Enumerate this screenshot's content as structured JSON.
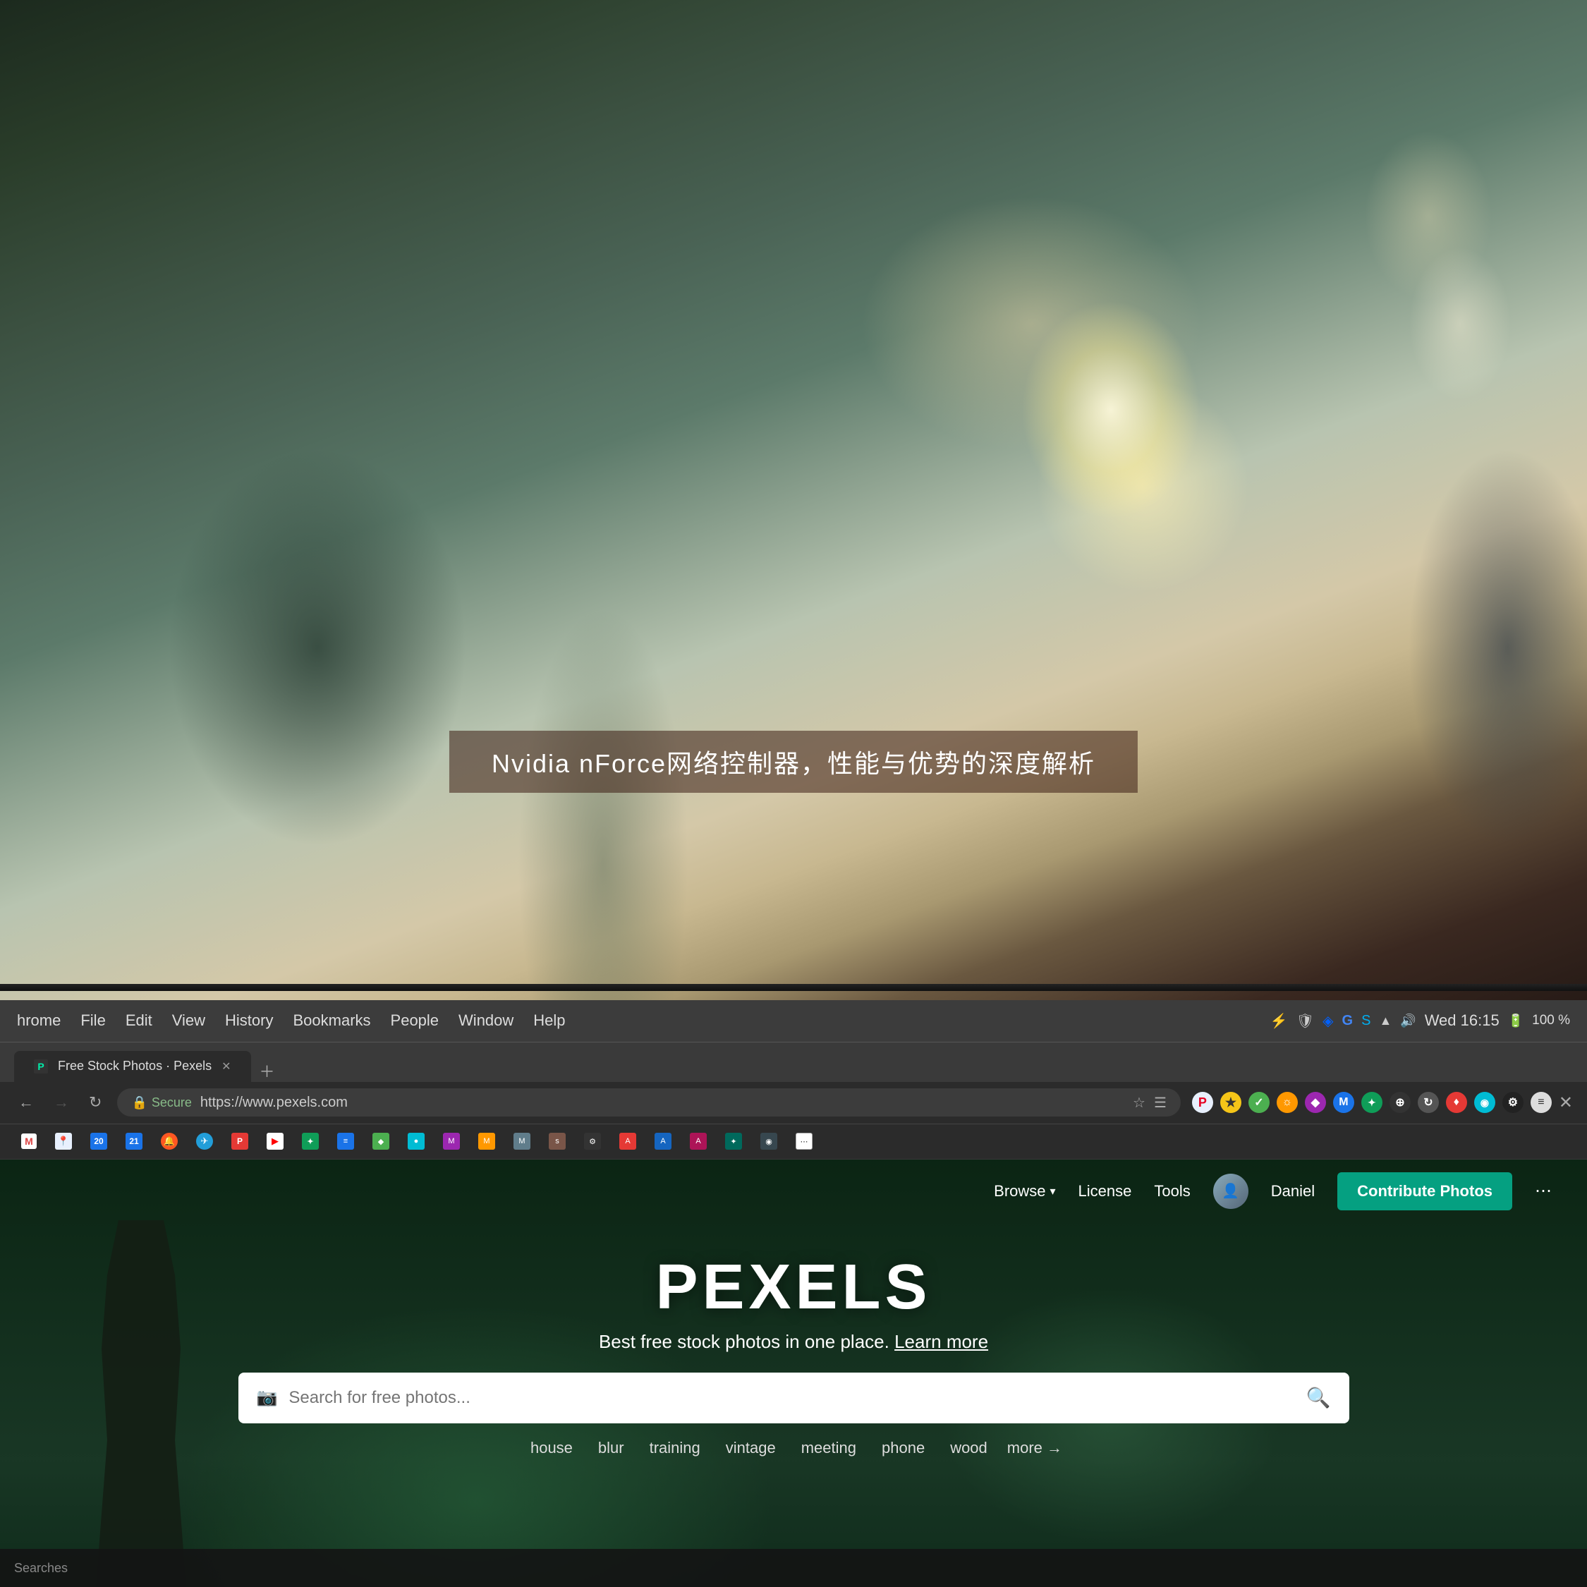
{
  "photo": {
    "chinese_text": "Nvidia nForce网络控制器，性能与优势的深度解析"
  },
  "chrome_os_bar": {
    "menu_items": [
      "hrome",
      "File",
      "Edit",
      "View",
      "History",
      "Bookmarks",
      "People",
      "Window",
      "Help"
    ],
    "time": "Wed 16:15",
    "battery": "100 %"
  },
  "browser": {
    "tab": {
      "label": "Free Stock Photos · Pexels",
      "favicon": "P"
    },
    "address": {
      "secure_label": "Secure",
      "url": "https://www.pexels.com"
    }
  },
  "pexels": {
    "nav": {
      "browse_label": "Browse",
      "license_label": "License",
      "tools_label": "Tools",
      "user_name": "Daniel",
      "contribute_label": "Contribute Photos"
    },
    "hero": {
      "logo": "PEXELS",
      "tagline": "Best free stock photos in one place.",
      "learn_more": "Learn more",
      "search_placeholder": "Search for free photos..."
    },
    "quick_tags": [
      "house",
      "blur",
      "training",
      "vintage",
      "meeting",
      "phone",
      "wood",
      "more →"
    ]
  },
  "taskbar": {
    "left_text": "Searches"
  }
}
